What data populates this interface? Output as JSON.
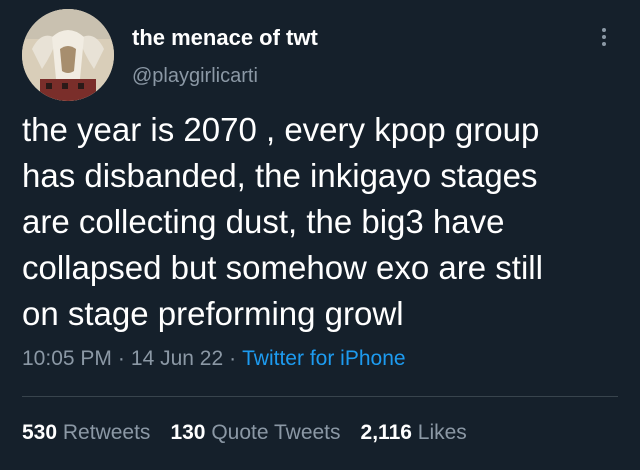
{
  "user": {
    "display_name": "the menace of twt",
    "handle": "@playgirlicarti"
  },
  "tweet": {
    "lines": [
      "the year is 2070 , every kpop group",
      "has disbanded, the inkigayo stages",
      "are collecting dust, the big3 have",
      "collapsed but somehow exo are still",
      "on stage preforming growl"
    ],
    "time": "10:05 PM",
    "date": "14 Jun 22",
    "separator": "·",
    "source": "Twitter for iPhone"
  },
  "stats": {
    "retweets_count": "530",
    "retweets_label": "Retweets",
    "quotes_count": "130",
    "quotes_label": "Quote Tweets",
    "likes_count": "2,116",
    "likes_label": "Likes"
  },
  "icons": {
    "more": "more-options-icon",
    "avatar": "avatar"
  },
  "colors": {
    "background": "#15202b",
    "primary_text": "#ffffff",
    "secondary_text": "#8b98a5",
    "accent": "#1d9bf0",
    "divider": "#38444d"
  }
}
